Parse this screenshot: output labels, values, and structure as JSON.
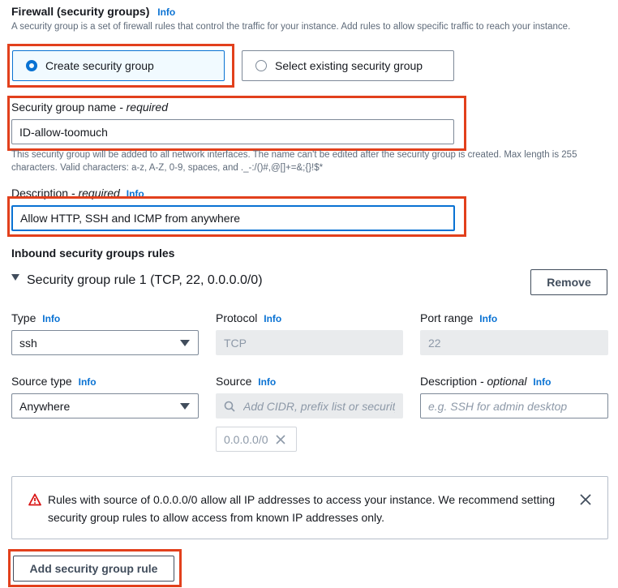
{
  "firewall": {
    "title": "Firewall (security groups)",
    "info": "Info",
    "description": "A security group is a set of firewall rules that control the traffic for your instance. Add rules to allow specific traffic to reach your instance.",
    "create_option": "Create security group",
    "select_option": "Select existing security group"
  },
  "group_name": {
    "label": "Security group name",
    "required": "- required",
    "value": "ID-allow-toomuch",
    "hint": "This security group will be added to all network interfaces. The name can't be edited after the security group is created. Max length is 255 characters. Valid characters: a-z, A-Z, 0-9, spaces, and ._-:/()#,@[]+=&;{}!$*"
  },
  "description": {
    "label": "Description",
    "required": "- required",
    "info": "Info",
    "value": "Allow HTTP, SSH and ICMP from anywhere"
  },
  "inbound": {
    "title": "Inbound security groups rules",
    "rule_title": "Security group rule 1 (TCP, 22, 0.0.0.0/0)",
    "remove_label": "Remove",
    "type_label": "Type",
    "type_value": "ssh",
    "protocol_label": "Protocol",
    "protocol_value": "TCP",
    "port_label": "Port range",
    "port_value": "22",
    "source_type_label": "Source type",
    "source_type_value": "Anywhere",
    "source_label": "Source",
    "source_placeholder": "Add CIDR, prefix list or security",
    "source_token": "0.0.0.0/0",
    "rule_desc_label": "Description",
    "rule_desc_optional": "- optional",
    "rule_desc_placeholder": "e.g. SSH for admin desktop",
    "info": "Info"
  },
  "warning": {
    "text_line1": "Rules with source of 0.0.0.0/0 allow all IP addresses to access your instance. We recommend setting",
    "text_line2": "security group rules to allow access from known IP addresses only."
  },
  "add_rule_label": "Add security group rule",
  "colors": {
    "accent": "#0972d3",
    "highlight": "#e2401c",
    "warning": "#d91515"
  }
}
